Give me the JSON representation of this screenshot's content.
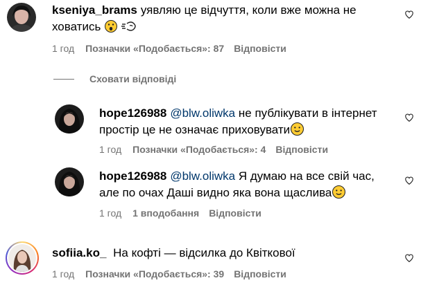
{
  "comments": [
    {
      "username": "kseniya_brams",
      "line1": "уявляю це відчуття, коли вже можна не",
      "line2": "ховатись",
      "time": "1 год",
      "likes": "Позначки «Подобається»: 87",
      "reply": "Відповісти"
    },
    {
      "username": "sofiia.ko_",
      "line1": "На кофті — відсилка до Квіткової",
      "time": "1 год",
      "likes": "Позначки «Подобається»: 39",
      "reply": "Відповісти"
    }
  ],
  "hide_replies": "Сховати відповіді",
  "replies": [
    {
      "username": "hope126988",
      "mention": "@blw.oliwka",
      "line1": "не публікувати в інтернет",
      "line2": "простір це не означає приховувати",
      "time": "1 год",
      "likes": "Позначки «Подобається»: 4",
      "reply": "Відповісти"
    },
    {
      "username": "hope126988",
      "mention": "@blw.oliwka",
      "line1": "Я думаю на все свій час,",
      "line2": "але по очах Даші видно яка вона щаслива",
      "time": "1 год",
      "likes": "1 вподобання",
      "reply": "Відповісти"
    }
  ],
  "icons": {
    "heart": "heart-outline-icon",
    "emoji_surprised": "surprised-face-emoji",
    "emoji_wind": "wind-blowing-emoji",
    "emoji_smile": "slightly-smiling-face-emoji"
  },
  "colors": {
    "mention": "#00376b",
    "meta": "#737373"
  }
}
